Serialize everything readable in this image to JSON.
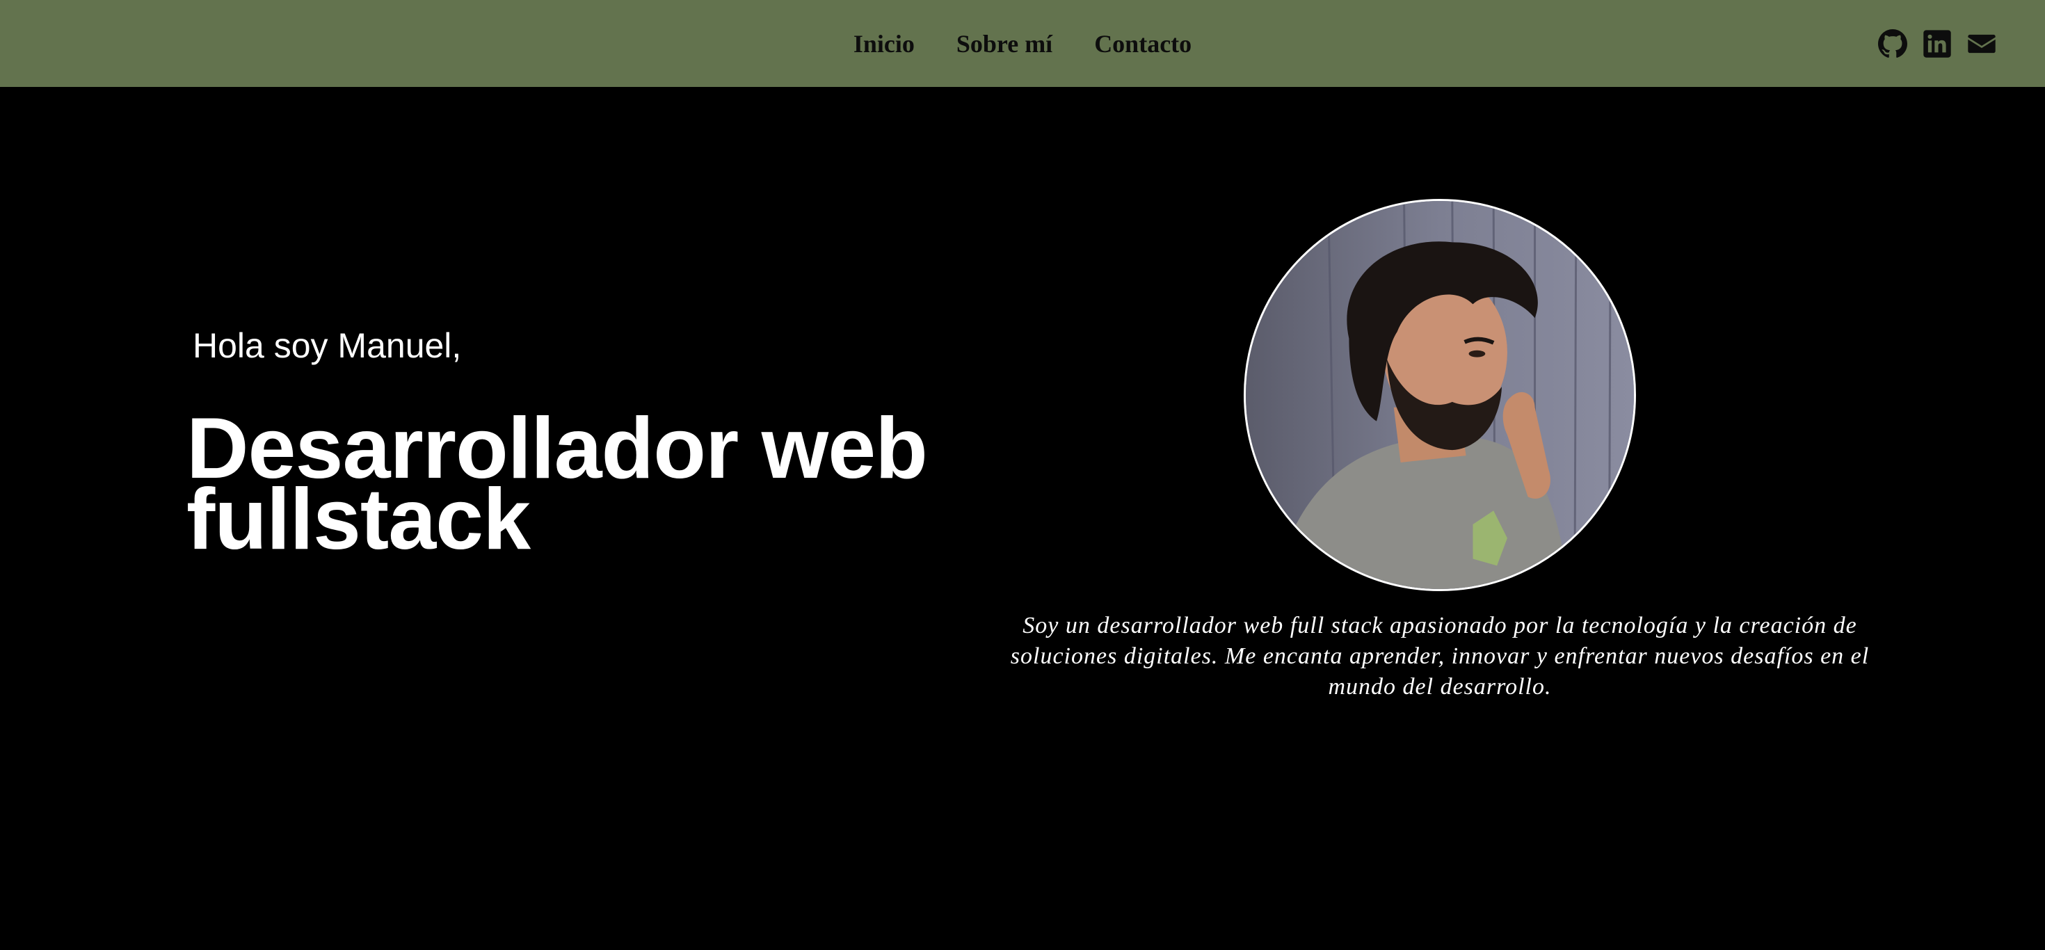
{
  "nav": {
    "links": [
      {
        "label": "Inicio"
      },
      {
        "label": "Sobre mí"
      },
      {
        "label": "Contacto"
      }
    ],
    "social_icons": [
      "github-icon",
      "linkedin-icon",
      "envelope-icon"
    ]
  },
  "hero": {
    "greeting": "Hola soy Manuel,",
    "headline": "Desarrollador web fullstack"
  },
  "about": {
    "bio": "Soy un desarrollador web full stack apasionado por la tecnología y la creación de soluciones digitales. Me encanta aprender, innovar y enfrentar nuevos desafíos en el mundo del desarrollo."
  },
  "colors": {
    "navbar_bg": "#63734e",
    "page_bg": "#000000",
    "text": "#ffffff",
    "nav_text": "#0d0d0d"
  }
}
